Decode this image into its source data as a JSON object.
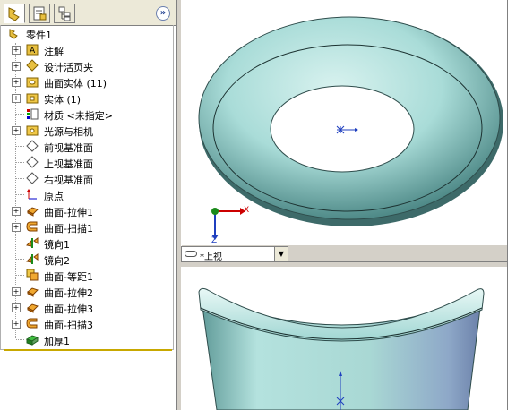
{
  "feature_tree": {
    "root": "零件1",
    "items": [
      {
        "label": "注解",
        "icon": "annotation-icon",
        "expandable": true
      },
      {
        "label": "设计活页夹",
        "icon": "design-binder-icon",
        "expandable": true
      },
      {
        "label": "曲面实体 (11)",
        "icon": "surface-bodies-folder-icon",
        "expandable": true
      },
      {
        "label": "实体 (1)",
        "icon": "solid-bodies-folder-icon",
        "expandable": true
      },
      {
        "label": "材质 <未指定>",
        "icon": "material-icon",
        "expandable": false
      },
      {
        "label": "光源与相机",
        "icon": "lights-cameras-icon",
        "expandable": true
      },
      {
        "label": "前视基准面",
        "icon": "plane-icon",
        "expandable": false
      },
      {
        "label": "上视基准面",
        "icon": "plane-icon",
        "expandable": false
      },
      {
        "label": "右视基准面",
        "icon": "plane-icon",
        "expandable": false
      },
      {
        "label": "原点",
        "icon": "origin-icon",
        "expandable": false
      },
      {
        "label": "曲面-拉伸1",
        "icon": "surface-extrude-icon",
        "expandable": true
      },
      {
        "label": "曲面-扫描1",
        "icon": "surface-sweep-icon",
        "expandable": true
      },
      {
        "label": "镜向1",
        "icon": "mirror-icon",
        "expandable": false
      },
      {
        "label": "镜向2",
        "icon": "mirror-icon",
        "expandable": false
      },
      {
        "label": "曲面-等距1",
        "icon": "surface-offset-icon",
        "expandable": false
      },
      {
        "label": "曲面-拉伸2",
        "icon": "surface-extrude-icon",
        "expandable": true
      },
      {
        "label": "曲面-拉伸3",
        "icon": "surface-extrude-icon",
        "expandable": true
      },
      {
        "label": "曲面-扫描3",
        "icon": "surface-sweep-icon",
        "expandable": true
      },
      {
        "label": "加厚1",
        "icon": "thicken-icon",
        "expandable": false
      }
    ]
  },
  "viewport": {
    "view_name": "*上视",
    "axis_x": "X",
    "axis_z": "Z"
  },
  "colors": {
    "model": "#9fd6d2",
    "model_dark": "#5f9a98",
    "axis_x": "#cc0000",
    "axis_z": "#1f3fbf",
    "axis_y": "#1a8a1a"
  }
}
